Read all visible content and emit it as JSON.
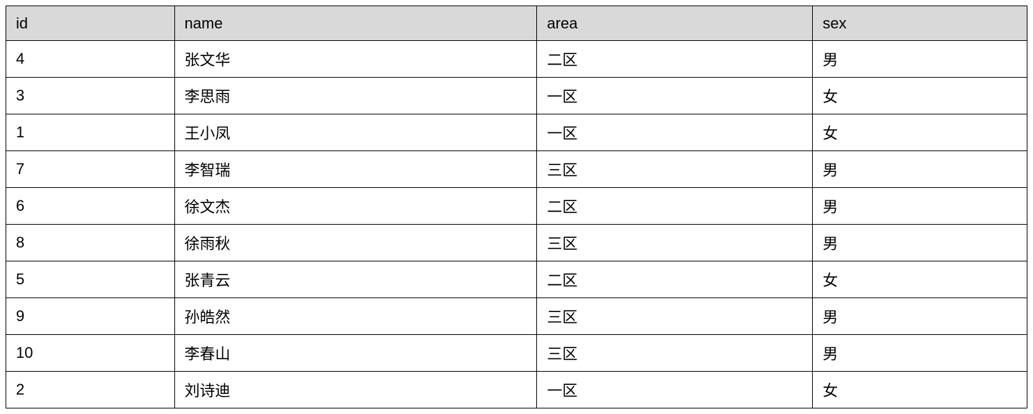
{
  "table": {
    "headers": {
      "id": "id",
      "name": "name",
      "area": "area",
      "sex": "sex"
    },
    "rows": [
      {
        "id": "4",
        "name": "张文华",
        "area": "二区",
        "sex": "男"
      },
      {
        "id": "3",
        "name": "李思雨",
        "area": "一区",
        "sex": "女"
      },
      {
        "id": "1",
        "name": "王小凤",
        "area": "一区",
        "sex": "女"
      },
      {
        "id": "7",
        "name": "李智瑞",
        "area": "三区",
        "sex": "男"
      },
      {
        "id": "6",
        "name": "徐文杰",
        "area": "二区",
        "sex": "男"
      },
      {
        "id": "8",
        "name": "徐雨秋",
        "area": "三区",
        "sex": "男"
      },
      {
        "id": "5",
        "name": "张青云",
        "area": "二区",
        "sex": "女"
      },
      {
        "id": "9",
        "name": "孙皓然",
        "area": "三区",
        "sex": "男"
      },
      {
        "id": "10",
        "name": "李春山",
        "area": "三区",
        "sex": "男"
      },
      {
        "id": "2",
        "name": "刘诗迪",
        "area": "一区",
        "sex": "女"
      }
    ]
  }
}
